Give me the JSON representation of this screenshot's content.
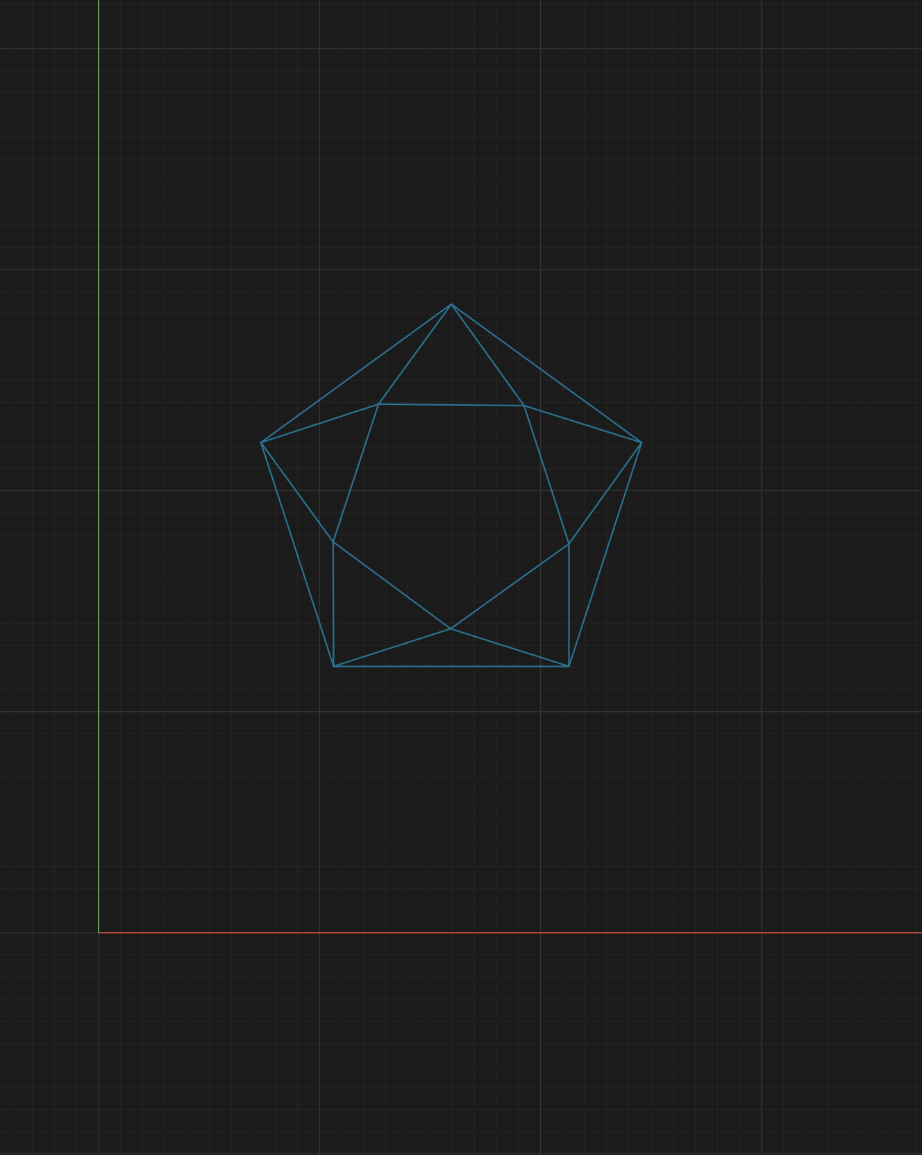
{
  "colors": {
    "background": "#1b1b1c",
    "grid_minor": "#262628",
    "grid_major": "#333336",
    "axis_x": "#b8473e",
    "axis_y": "#6a9a4f",
    "wireframe": "#2b7493"
  },
  "icons": [],
  "mesh": {
    "vertices": [
      [
        0.0,
        3.0
      ],
      [
        -2.6625,
        1.0661
      ],
      [
        2.6625,
        1.0661
      ],
      [
        -1.6455,
        -2.0623
      ],
      [
        1.6455,
        -2.0623
      ],
      [
        -1.0177,
        1.6029
      ],
      [
        1.0177,
        1.5823
      ],
      [
        -1.6519,
        -0.3223
      ],
      [
        1.6455,
        -0.3493
      ],
      [
        -0.0085,
        -1.5369
      ]
    ],
    "edges": [
      [
        0,
        1
      ],
      [
        0,
        2
      ],
      [
        1,
        3
      ],
      [
        2,
        4
      ],
      [
        3,
        4
      ],
      [
        0,
        5
      ],
      [
        0,
        6
      ],
      [
        5,
        6
      ],
      [
        1,
        5
      ],
      [
        1,
        7
      ],
      [
        5,
        7
      ],
      [
        2,
        6
      ],
      [
        2,
        8
      ],
      [
        6,
        8
      ],
      [
        7,
        3
      ],
      [
        7,
        9
      ],
      [
        3,
        9
      ],
      [
        8,
        4
      ],
      [
        8,
        9
      ],
      [
        4,
        9
      ]
    ]
  }
}
